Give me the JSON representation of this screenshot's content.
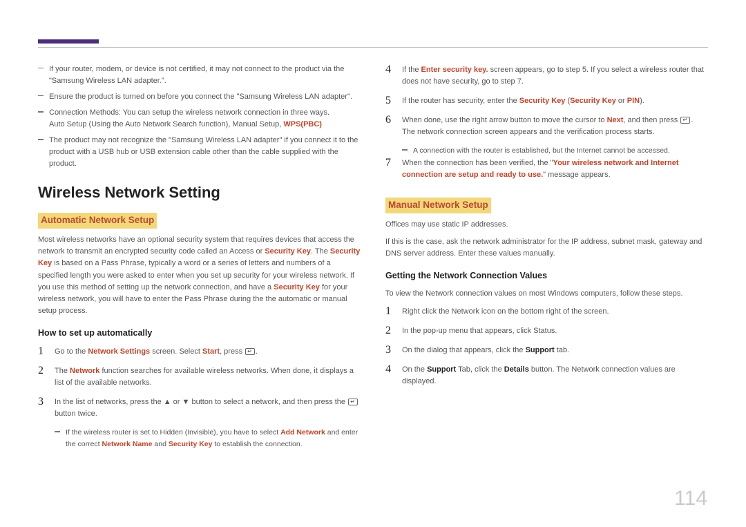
{
  "page_number": "114",
  "left": {
    "intro_bullets": {
      "b1": "If your router, modem, or device is not certified, it may not connect to the product via the \"Samsung Wireless LAN adapter.\".",
      "b2": "Ensure the product is turned on before you connect the \"Samsung Wireless LAN adapter\".",
      "b3_a": "Connection Methods: You can setup the wireless network connection in three ways.",
      "b3_b": "Auto Setup (Using the Auto Network Search function), Manual Setup, ",
      "b3_c": "WPS(PBC)",
      "b4": "The product may not recognize the \"Samsung Wireless LAN adapter\" if you connect it to the product with a USB hub or USB extension cable other than the cable supplied with the product."
    },
    "h1": "Wireless Network Setting",
    "auto_head": "Automatic Network Setup",
    "auto_para_a": "Most wireless networks have an optional security system that requires devices that access the network to transmit an encrypted security code called an Access or ",
    "auto_para_b": "Security Key",
    "auto_para_c": ". The ",
    "auto_para_d": "Security Key",
    "auto_para_e": " is based on a Pass Phrase, typically a word or a series of letters and numbers of a specified length you were asked to enter when you set up security for your wireless network. If you use this method of setting up the network connection, and have a ",
    "auto_para_f": "Security Key",
    "auto_para_g": " for your wireless network, you will have to enter the Pass Phrase during the the automatic or manual setup process.",
    "howto_head": "How to set up automatically",
    "steps": {
      "s1_a": "Go to the ",
      "s1_b": "Network Settings",
      "s1_c": " screen. Select ",
      "s1_d": "Start",
      "s1_e": ", press ",
      "s1_f": ".",
      "s2_a": "The ",
      "s2_b": "Network",
      "s2_c": " function searches for available wireless networks. When done, it displays a list of the available networks.",
      "s3_a": "In the list of networks, press the ▲ or ▼ button to select a network, and then press the ",
      "s3_b": " button twice.",
      "s3_note_a": "If the wireless router is set to Hidden (Invisible), you have to select ",
      "s3_note_b": "Add Network",
      "s3_note_c": " and enter the correct ",
      "s3_note_d": "Network Name",
      "s3_note_e": " and ",
      "s3_note_f": "Security Key",
      "s3_note_g": " to establish the connection."
    }
  },
  "right": {
    "steps": {
      "s4_a": "If the ",
      "s4_b": "Enter security key.",
      "s4_c": " screen appears, go to step 5. If you select a wireless router that does not have security, go to step 7.",
      "s5_a": "If the router has security, enter the ",
      "s5_b": "Security Key",
      "s5_c": " (",
      "s5_d": "Security Key",
      "s5_e": " or ",
      "s5_f": "PIN",
      "s5_g": ").",
      "s6_a": "When done, use the right arrow button to move the cursor to ",
      "s6_b": "Next",
      "s6_c": ", and then press ",
      "s6_d": ". The network connection screen appears and the verification process starts.",
      "s6_note": "A connection with the router is established, but the Internet cannot be accessed.",
      "s7_a": "When the connection has been verified, the \"",
      "s7_b": "Your wireless network and Internet connection are setup and ready to use.",
      "s7_c": "\" message appears."
    },
    "manual_head": "Manual Network Setup",
    "manual_p1": "Offices may use static IP addresses.",
    "manual_p2": "If this is the case, ask the network administrator for the IP address, subnet mask, gateway and DNS server address. Enter these values manually.",
    "getv_head": "Getting the Network Connection Values",
    "getv_p": "To view the Network connection values on most Windows computers, follow these steps.",
    "vsteps": {
      "v1": "Right click the Network icon on the bottom right of the screen.",
      "v2": "In the pop-up menu that appears, click Status.",
      "v3_a": "On the dialog that appears, click the ",
      "v3_b": "Support",
      "v3_c": " tab.",
      "v4_a": "On the ",
      "v4_b": "Support",
      "v4_c": " Tab, click the ",
      "v4_d": "Details",
      "v4_e": " button. The Network connection values are displayed."
    }
  }
}
